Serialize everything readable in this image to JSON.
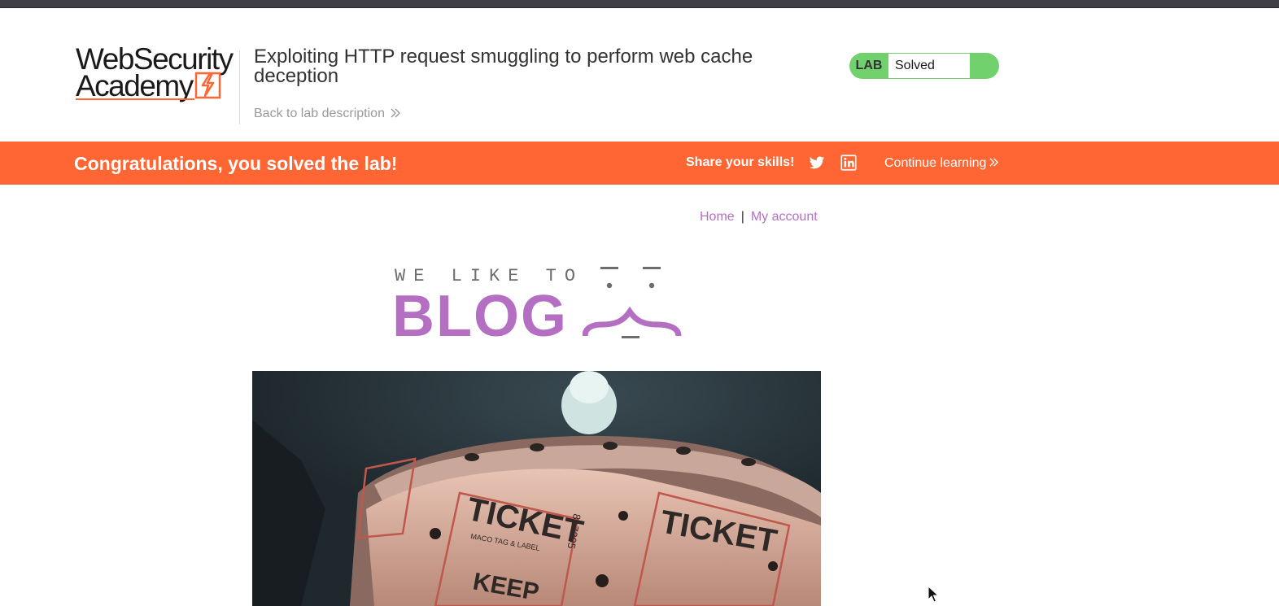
{
  "academy": {
    "logo_line1": "WebSecurity",
    "logo_line2": "Academy",
    "lab_title": "Exploiting HTTP request smuggling to perform web cache deception",
    "back_link": "Back to lab description",
    "lab_tag": "LAB",
    "lab_status": "Solved"
  },
  "banner": {
    "message": "Congratulations, you solved the lab!",
    "share_label": "Share your skills!",
    "continue_label": "Continue learning"
  },
  "nav": {
    "home": "Home",
    "separator": "|",
    "account": "My account"
  },
  "blog_logo": {
    "tagline": "WE LIKE TO",
    "word": "BLOG"
  },
  "hero": {
    "ticket_text": "TICKET",
    "keep_text": "KEEP",
    "tag_text": "MACO TAG & LABEL",
    "serial": "817205"
  },
  "colors": {
    "accent_orange": "#ff6633",
    "lab_green": "#70d16d",
    "blog_purple": "#b46fc3"
  },
  "icons": [
    "academy-bolt-icon",
    "double-chevron-right-icon",
    "twitter-icon",
    "linkedin-icon",
    "mouse-cursor-icon"
  ]
}
